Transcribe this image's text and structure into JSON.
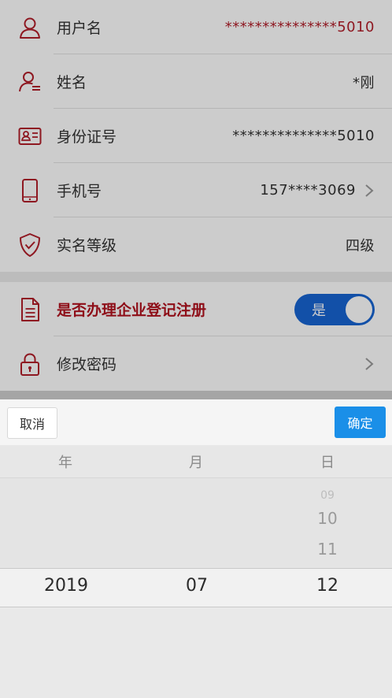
{
  "profile": {
    "username": {
      "label": "用户名",
      "value": "***************5010"
    },
    "name": {
      "label": "姓名",
      "value": "*刚"
    },
    "id_number": {
      "label": "身份证号",
      "value": "**************5010"
    },
    "phone": {
      "label": "手机号",
      "value": "157****3069"
    },
    "level": {
      "label": "实名等级",
      "value": "四级"
    }
  },
  "enterprise_reg": {
    "label": "是否办理企业登记注册",
    "toggle_label": "是",
    "on": true
  },
  "change_password": {
    "label": "修改密码"
  },
  "picker": {
    "cancel": "取消",
    "confirm": "确定",
    "headers": [
      "年",
      "月",
      "日"
    ],
    "year": "2019",
    "month": "07",
    "day_above": [
      "09",
      "10",
      "11"
    ],
    "day": "12"
  },
  "colors": {
    "accent": "#b21e2a",
    "primary": "#1a8fe8",
    "toggle": "#1765d3"
  }
}
